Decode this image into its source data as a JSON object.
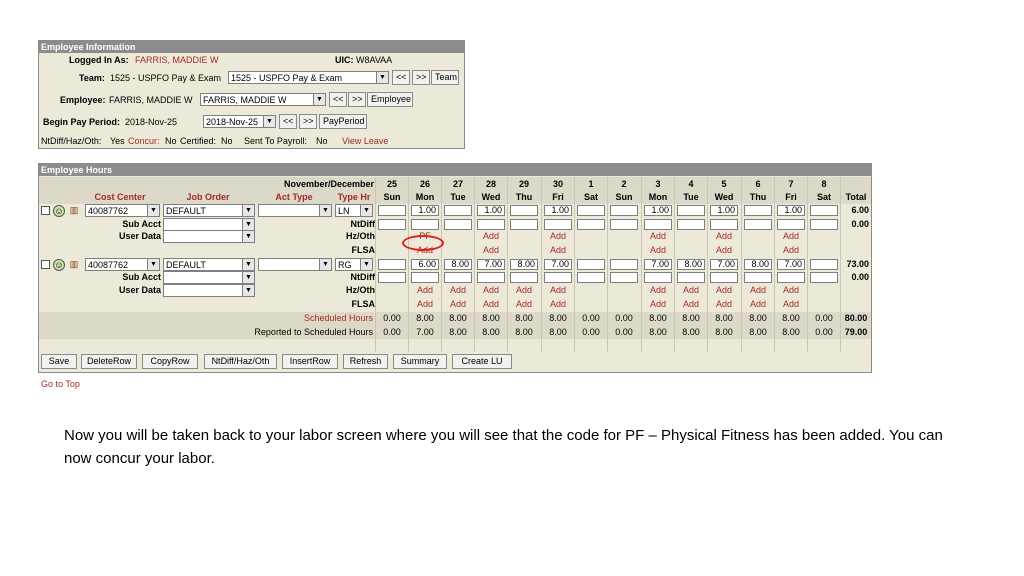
{
  "info": {
    "title": "Employee Information",
    "logged_label": "Logged In As:",
    "logged_value": "FARRIS, MADDIE W",
    "uic_label": "UIC:",
    "uic_value": "W8AVAA",
    "team_label": "Team:",
    "team_value": "1525 - USPFO Pay & Exam",
    "team_select": "1525 - USPFO Pay & Exam",
    "team_btn": "Team",
    "employee_label": "Employee:",
    "employee_value": "FARRIS, MADDIE W",
    "employee_select": "FARRIS, MADDIE W",
    "employee_btn": "Employee",
    "begin_label": "Begin Pay Period:",
    "begin_value": "2018-Nov-25",
    "begin_select": "2018-Nov-25",
    "payperiod_btn": "PayPeriod",
    "prev": "<<",
    "next": ">>",
    "ntdiff_label": "NtDiff/Haz/Oth:",
    "ntdiff_value": "Yes",
    "concur_label": "Concur:",
    "concur_value": "No",
    "certified_label": "Certified:",
    "certified_value": "No",
    "sent_label": "Sent To Payroll:",
    "sent_value": "No",
    "view_leave": "View Leave"
  },
  "hours": {
    "title": "Employee Hours",
    "month_label": "November/December",
    "dates": [
      "25",
      "26",
      "27",
      "28",
      "29",
      "30",
      "1",
      "2",
      "3",
      "4",
      "5",
      "6",
      "7",
      "8"
    ],
    "days": [
      "Sun",
      "Mon",
      "Tue",
      "Wed",
      "Thu",
      "Fri",
      "Sat",
      "Sun",
      "Mon",
      "Tue",
      "Wed",
      "Thu",
      "Fri",
      "Sat"
    ],
    "total_label": "Total",
    "col_cost": "Cost Center",
    "col_job": "Job Order",
    "col_act": "Act Type",
    "col_type": "Type Hr",
    "sub_acct": "Sub Acct",
    "user_data": "User Data",
    "ntdiff": "NtDiff",
    "hzoth": "Hz/Oth",
    "flsa": "FLSA",
    "entries": [
      {
        "cost": "40087762",
        "job": "DEFAULT",
        "type": "LN",
        "hours": [
          "",
          "1.00",
          "",
          "1.00",
          "",
          "1.00",
          "",
          "",
          "1.00",
          "",
          "1.00",
          "",
          "1.00",
          ""
        ],
        "total": "6.00",
        "ntdiff_total": "0.00",
        "hzoth": [
          "",
          "PF",
          "",
          "Add",
          "",
          "Add",
          "",
          "",
          "Add",
          "",
          "Add",
          "",
          "Add",
          ""
        ],
        "flsa": [
          "",
          "Add",
          "",
          "Add",
          "",
          "Add",
          "",
          "",
          "Add",
          "",
          "Add",
          "",
          "Add",
          ""
        ]
      },
      {
        "cost": "40087762",
        "job": "DEFAULT",
        "type": "RG",
        "hours": [
          "",
          "6.00",
          "8.00",
          "7.00",
          "8.00",
          "7.00",
          "",
          "",
          "7.00",
          "8.00",
          "7.00",
          "8.00",
          "7.00",
          ""
        ],
        "total": "73.00",
        "ntdiff_total": "0.00",
        "hzoth": [
          "",
          "Add",
          "Add",
          "Add",
          "Add",
          "Add",
          "",
          "",
          "Add",
          "Add",
          "Add",
          "Add",
          "Add",
          ""
        ],
        "flsa": [
          "",
          "Add",
          "Add",
          "Add",
          "Add",
          "Add",
          "",
          "",
          "Add",
          "Add",
          "Add",
          "Add",
          "Add",
          ""
        ]
      }
    ],
    "scheduled_label": "Scheduled Hours",
    "scheduled": [
      "0.00",
      "8.00",
      "8.00",
      "8.00",
      "8.00",
      "8.00",
      "0.00",
      "0.00",
      "8.00",
      "8.00",
      "8.00",
      "8.00",
      "8.00",
      "0.00"
    ],
    "scheduled_total": "80.00",
    "reported_label": "Reported to Scheduled Hours",
    "reported": [
      "0.00",
      "7.00",
      "8.00",
      "8.00",
      "8.00",
      "8.00",
      "0.00",
      "0.00",
      "8.00",
      "8.00",
      "8.00",
      "8.00",
      "8.00",
      "0.00"
    ],
    "reported_total": "79.00"
  },
  "buttons": {
    "save": "Save",
    "deleterow": "DeleteRow",
    "copyrow": "CopyRow",
    "ntdiff": "NtDiff/Haz/Oth",
    "insertrow": "InsertRow",
    "refresh": "Refresh",
    "summary": "Summary",
    "createlu": "Create LU"
  },
  "goto_top": "Go to Top",
  "caption": "Now you will be taken back to your labor screen where you will see that the code for PF – Physical Fitness has been added. You can now concur your labor."
}
